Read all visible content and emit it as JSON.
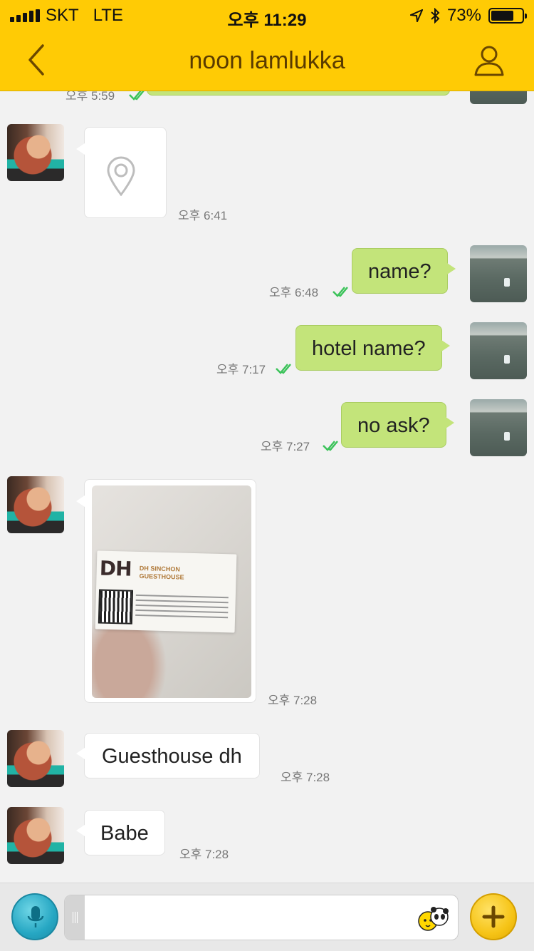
{
  "status_bar": {
    "carrier": "SKT",
    "network": "LTE",
    "time": "오후 11:29",
    "battery": "73%",
    "battery_level": 0.73
  },
  "header": {
    "title": "noon lamlukka"
  },
  "messages": [
    {
      "type": "partial",
      "direction": "out",
      "time": "오후 5:59"
    },
    {
      "type": "location",
      "direction": "in",
      "time": "오후 6:41"
    },
    {
      "type": "text",
      "direction": "out",
      "text": "name?",
      "time": "오후 6:48",
      "read": true
    },
    {
      "type": "text",
      "direction": "out",
      "text": "hotel name?",
      "time": "오후 7:17",
      "read": true
    },
    {
      "type": "text",
      "direction": "out",
      "text": "no ask?",
      "time": "오후 7:27",
      "read": true
    },
    {
      "type": "photo",
      "direction": "in",
      "time": "오후 7:28",
      "photo_text": {
        "logo": "DH",
        "name_line1": "DH SINCHON",
        "name_line2": "GUESTHOUSE"
      }
    },
    {
      "type": "text",
      "direction": "in",
      "text": "Guesthouse dh",
      "time": "오후 7:28"
    },
    {
      "type": "text",
      "direction": "in",
      "text": "Babe",
      "time": "오후 7:28"
    }
  ],
  "input_bar": {
    "placeholder": "",
    "icons": [
      "microphone-icon",
      "emoticon-icon",
      "plus-icon"
    ]
  },
  "colors": {
    "header": "#ffcb05",
    "outgoing_bubble": "#c3e47a",
    "incoming_bubble": "#ffffff",
    "read_check": "#3cc35a"
  }
}
